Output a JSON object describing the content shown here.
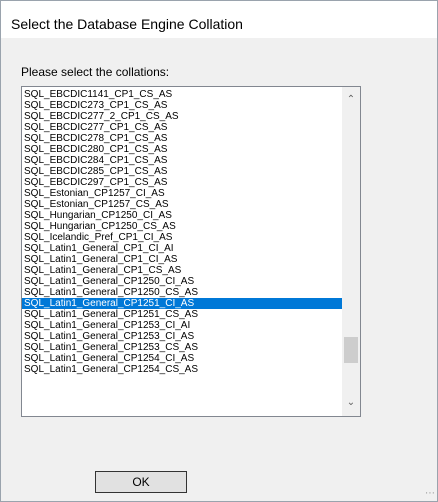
{
  "dialog": {
    "title": "Select the Database Engine Collation",
    "prompt": "Please select the collations:",
    "ok_label": "OK"
  },
  "icons": {
    "scroll_up": "chevron-up-icon",
    "scroll_down": "chevron-down-icon"
  },
  "collations": {
    "selected_index": 19,
    "scroll_position": 0.88,
    "items": [
      "SQL_EBCDIC1141_CP1_CS_AS",
      "SQL_EBCDIC273_CP1_CS_AS",
      "SQL_EBCDIC277_2_CP1_CS_AS",
      "SQL_EBCDIC277_CP1_CS_AS",
      "SQL_EBCDIC278_CP1_CS_AS",
      "SQL_EBCDIC280_CP1_CS_AS",
      "SQL_EBCDIC284_CP1_CS_AS",
      "SQL_EBCDIC285_CP1_CS_AS",
      "SQL_EBCDIC297_CP1_CS_AS",
      "SQL_Estonian_CP1257_CI_AS",
      "SQL_Estonian_CP1257_CS_AS",
      "SQL_Hungarian_CP1250_CI_AS",
      "SQL_Hungarian_CP1250_CS_AS",
      "SQL_Icelandic_Pref_CP1_CI_AS",
      "SQL_Latin1_General_CP1_CI_AI",
      "SQL_Latin1_General_CP1_CI_AS",
      "SQL_Latin1_General_CP1_CS_AS",
      "SQL_Latin1_General_CP1250_CI_AS",
      "SQL_Latin1_General_CP1250_CS_AS",
      "SQL_Latin1_General_CP1251_CI_AS",
      "SQL_Latin1_General_CP1251_CS_AS",
      "SQL_Latin1_General_CP1253_CI_AI",
      "SQL_Latin1_General_CP1253_CI_AS",
      "SQL_Latin1_General_CP1253_CS_AS",
      "SQL_Latin1_General_CP1254_CI_AS",
      "SQL_Latin1_General_CP1254_CS_AS"
    ]
  },
  "colors": {
    "selection": "#0078d7",
    "selection_text": "#ffffff"
  }
}
